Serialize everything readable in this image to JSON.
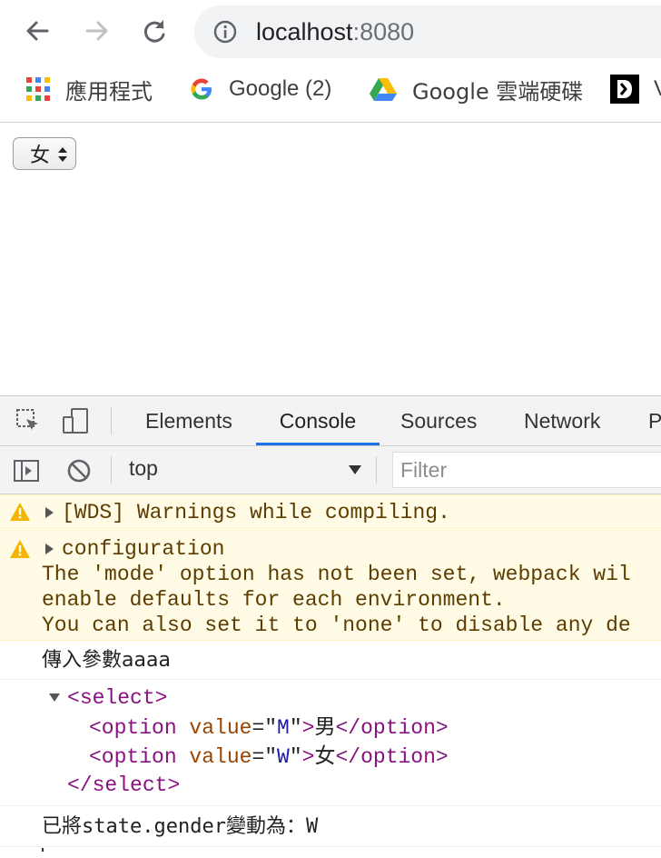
{
  "browser": {
    "url_host": "localhost",
    "url_port": ":8080",
    "bookmarks": [
      {
        "label": "應用程式",
        "icon": "apps-grid-icon"
      },
      {
        "label": "Google (2)",
        "icon": "google-icon"
      },
      {
        "label": "Google 雲端硬碟",
        "icon": "google-drive-icon"
      },
      {
        "label": "V",
        "icon": "bookmark-logo-icon"
      }
    ],
    "nav_icons": [
      "back-arrow-icon",
      "forward-arrow-icon",
      "reload-icon",
      "info-icon"
    ]
  },
  "page": {
    "gender_select_value": "女"
  },
  "devtools": {
    "tabs": [
      "Elements",
      "Console",
      "Sources",
      "Network",
      "P"
    ],
    "active_tab": "Console",
    "context": "top",
    "filter_placeholder": "Filter",
    "console": {
      "warning1": "[WDS] Warnings while compiling.",
      "warning2_title": "configuration",
      "warning2_line1": "The 'mode' option has not been set, webpack wil",
      "warning2_line2": "enable defaults for each environment.",
      "warning2_line3": "You can also set it to 'none' to disable any de",
      "log1": "傳入參數aaaa",
      "select_open": "select",
      "option1_value": "M",
      "option1_text": "男",
      "option2_value": "W",
      "option2_text": "女",
      "select_close": "select",
      "log2": "已將state.gender變動為：W"
    }
  },
  "colors": {
    "active_tab_underline": "#1a73e8",
    "warning_bg": "#fffbe5",
    "warning_text": "#5c3c00",
    "html_tag": "#881280",
    "html_attr": "#994500",
    "html_attr_value": "#1a1aa6"
  }
}
